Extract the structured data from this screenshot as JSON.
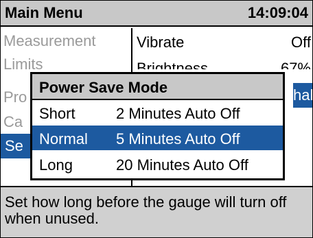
{
  "header": {
    "title": "Main Menu",
    "time": "14:09:04"
  },
  "menu": {
    "items": [
      "Measurement",
      "Limits",
      "Pro",
      "Ca",
      "Se"
    ],
    "selected_index": 4
  },
  "settings": [
    {
      "name": "Vibrate",
      "value": "Off"
    },
    {
      "name": "Brightness",
      "value": "67%"
    },
    {
      "name": "",
      "value": "hal"
    }
  ],
  "popup": {
    "title": "Power Save Mode",
    "options": [
      {
        "label": "Short",
        "desc": "2 Minutes Auto Off"
      },
      {
        "label": "Normal",
        "desc": "5 Minutes Auto Off"
      },
      {
        "label": "Long",
        "desc": "20 Minutes Auto Off"
      }
    ],
    "selected_index": 1
  },
  "help": {
    "text": "Set how long before the gauge will turn off when unused."
  },
  "colors": {
    "highlight": "#1d5aa0",
    "header_bg": "#c8c8c8",
    "help_bg": "#d0d0d0"
  }
}
